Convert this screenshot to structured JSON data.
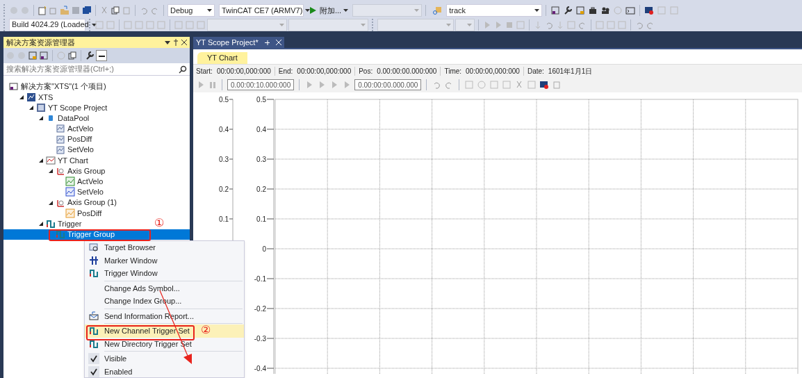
{
  "toolbar_top": {
    "config": "Debug",
    "platform": "TwinCAT CE7 (ARMV7)",
    "attach": "附加...",
    "find": "track"
  },
  "toolbar_second": {
    "build": "Build 4024.29 (Loaded"
  },
  "explorer": {
    "title": "解决方案资源管理器",
    "search": {
      "placeholder": "搜索解决方案资源管理器(Ctrl+;)"
    },
    "tree": [
      {
        "label": "解决方案\"XTS\"(1 个项目)",
        "kind": "solution",
        "selected": false,
        "children": [
          {
            "label": "XTS",
            "kind": "project",
            "selected": false,
            "expanded": true,
            "children": [
              {
                "label": "YT Scope Project",
                "kind": "scope",
                "selected": false,
                "expanded": true,
                "children": [
                  {
                    "label": "DataPool",
                    "kind": "datapool",
                    "selected": false,
                    "expanded": true,
                    "children": [
                      {
                        "label": "ActVelo",
                        "kind": "channel",
                        "selected": false
                      },
                      {
                        "label": "PosDiff",
                        "kind": "channel",
                        "selected": false
                      },
                      {
                        "label": "SetVelo",
                        "kind": "channel",
                        "selected": false
                      }
                    ]
                  },
                  {
                    "label": "YT Chart",
                    "kind": "chart",
                    "selected": false,
                    "expanded": true,
                    "children": [
                      {
                        "label": "Axis Group",
                        "kind": "axis",
                        "selected": false,
                        "expanded": true,
                        "children": [
                          {
                            "label": "ActVelo",
                            "kind": "green",
                            "selected": false
                          },
                          {
                            "label": "SetVelo",
                            "kind": "blue",
                            "selected": false
                          }
                        ]
                      },
                      {
                        "label": "Axis Group (1)",
                        "kind": "axis",
                        "selected": false,
                        "expanded": true,
                        "children": [
                          {
                            "label": "PosDiff",
                            "kind": "orange",
                            "selected": false
                          }
                        ]
                      }
                    ]
                  },
                  {
                    "label": "Trigger",
                    "kind": "trigger",
                    "selected": false,
                    "expanded": true,
                    "children": [
                      {
                        "label": "Trigger Group",
                        "kind": "trigger",
                        "selected": true
                      }
                    ]
                  }
                ]
              }
            ]
          }
        ]
      }
    ]
  },
  "document_tab": {
    "title": "YT Scope Project*"
  },
  "chart_tab": {
    "label": "YT Chart",
    "selected": true
  },
  "info": [
    {
      "label": "Start:",
      "value": "00:00:00,000:000"
    },
    {
      "label": "End:",
      "value": "00:00:00,000:000"
    },
    {
      "label": "Pos:",
      "value": "0.00:00:00.000:000"
    },
    {
      "label": "Time:",
      "value": "00:00:00,000:000"
    },
    {
      "label": "Date:",
      "value": "1601年1月1日"
    }
  ],
  "playback": {
    "duration": "0.00:00:10.000:000",
    "position": "0.00:00:00.000.000"
  },
  "axes": [
    {
      "ticks": [
        "0.5",
        "0.4",
        "0.3",
        "0.2",
        "0.1"
      ]
    },
    {
      "ticks": [
        "0.5",
        "0.4",
        "0.3",
        "0.2",
        "0.1",
        "0",
        "-0.1",
        "-0.2",
        "-0.3",
        "-0.4"
      ]
    }
  ],
  "context_menu": {
    "groups": [
      [
        {
          "label": "Target Browser",
          "kind": "browser",
          "selected": false
        },
        {
          "label": "Marker Window",
          "kind": "marker",
          "selected": false
        },
        {
          "label": "Trigger Window",
          "kind": "trigger",
          "selected": false
        }
      ],
      [
        {
          "label": "Change Ads Symbol...",
          "kind": "plain",
          "selected": false
        },
        {
          "label": "Change Index Group...",
          "kind": "plain",
          "selected": false
        }
      ],
      [
        {
          "label": "Send Information Report...",
          "kind": "report",
          "selected": false
        }
      ],
      [
        {
          "label": "New Channel Trigger Set",
          "kind": "trigger",
          "selected": true
        },
        {
          "label": "New Directory Trigger Set",
          "kind": "trigger",
          "selected": false
        }
      ],
      [
        {
          "label": "Visible",
          "kind": "check",
          "selected": false,
          "checked": true
        },
        {
          "label": "Enabled",
          "kind": "check",
          "selected": false,
          "checked": true
        }
      ]
    ]
  },
  "annotations": [
    {
      "label": "①"
    },
    {
      "label": "②"
    }
  ]
}
